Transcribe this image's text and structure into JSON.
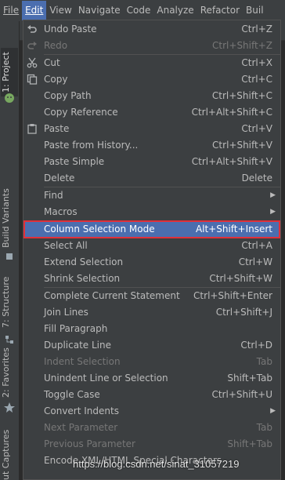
{
  "menubar": {
    "items": [
      {
        "label": "File"
      },
      {
        "label": "Edit"
      },
      {
        "label": "View"
      },
      {
        "label": "Navigate"
      },
      {
        "label": "Code"
      },
      {
        "label": "Analyze"
      },
      {
        "label": "Refactor"
      },
      {
        "label": "Buil"
      }
    ]
  },
  "toolstrip": {
    "tabs": [
      {
        "label": "1: Project"
      },
      {
        "label": "Build Variants"
      },
      {
        "label": "7: Structure"
      },
      {
        "label": "2: Favorites"
      },
      {
        "label": "ut Captures"
      }
    ]
  },
  "edit_menu": {
    "items": [
      {
        "label": "Undo Paste",
        "shortcut": "Ctrl+Z",
        "icon": "undo-icon"
      },
      {
        "label": "Redo",
        "shortcut": "Ctrl+Shift+Z",
        "icon": "redo-icon",
        "disabled": true
      },
      {
        "label": "Cut",
        "shortcut": "Ctrl+X",
        "icon": "scissors-icon"
      },
      {
        "label": "Copy",
        "shortcut": "Ctrl+C",
        "icon": "copy-icon"
      },
      {
        "label": "Copy Path",
        "shortcut": "Ctrl+Shift+C"
      },
      {
        "label": "Copy Reference",
        "shortcut": "Ctrl+Alt+Shift+C"
      },
      {
        "label": "Paste",
        "shortcut": "Ctrl+V",
        "icon": "paste-icon"
      },
      {
        "label": "Paste from History...",
        "shortcut": "Ctrl+Shift+V"
      },
      {
        "label": "Paste Simple",
        "shortcut": "Ctrl+Alt+Shift+V"
      },
      {
        "label": "Delete",
        "shortcut": "Delete"
      },
      {
        "label": "Find",
        "submenu": true
      },
      {
        "label": "Macros",
        "submenu": true
      },
      {
        "label": "Column Selection Mode",
        "shortcut": "Alt+Shift+Insert",
        "selected": true
      },
      {
        "label": "Select All",
        "shortcut": "Ctrl+A"
      },
      {
        "label": "Extend Selection",
        "shortcut": "Ctrl+W"
      },
      {
        "label": "Shrink Selection",
        "shortcut": "Ctrl+Shift+W"
      },
      {
        "label": "Complete Current Statement",
        "shortcut": "Ctrl+Shift+Enter"
      },
      {
        "label": "Join Lines",
        "shortcut": "Ctrl+Shift+J"
      },
      {
        "label": "Fill Paragraph",
        "shortcut": ""
      },
      {
        "label": "Duplicate Line",
        "shortcut": "Ctrl+D"
      },
      {
        "label": "Indent Selection",
        "shortcut": "Tab",
        "disabled": true
      },
      {
        "label": "Unindent Line or Selection",
        "shortcut": "Shift+Tab"
      },
      {
        "label": "Toggle Case",
        "shortcut": "Ctrl+Shift+U"
      },
      {
        "label": "Convert Indents",
        "submenu": true
      },
      {
        "label": "Next Parameter",
        "shortcut": "Tab",
        "disabled": true
      },
      {
        "label": "Previous Parameter",
        "shortcut": "Shift+Tab",
        "disabled": true
      },
      {
        "label": "Encode XML/HTML Special Characters",
        "shortcut": ""
      }
    ]
  },
  "watermark": "https://blog.csdn.net/sinat_31057219",
  "colors": {
    "menu_bg": "#3c3f41",
    "selection": "#4b6eaf",
    "highlight_box": "#e0303a",
    "text": "#bbbbbb",
    "disabled_text": "#777777"
  }
}
